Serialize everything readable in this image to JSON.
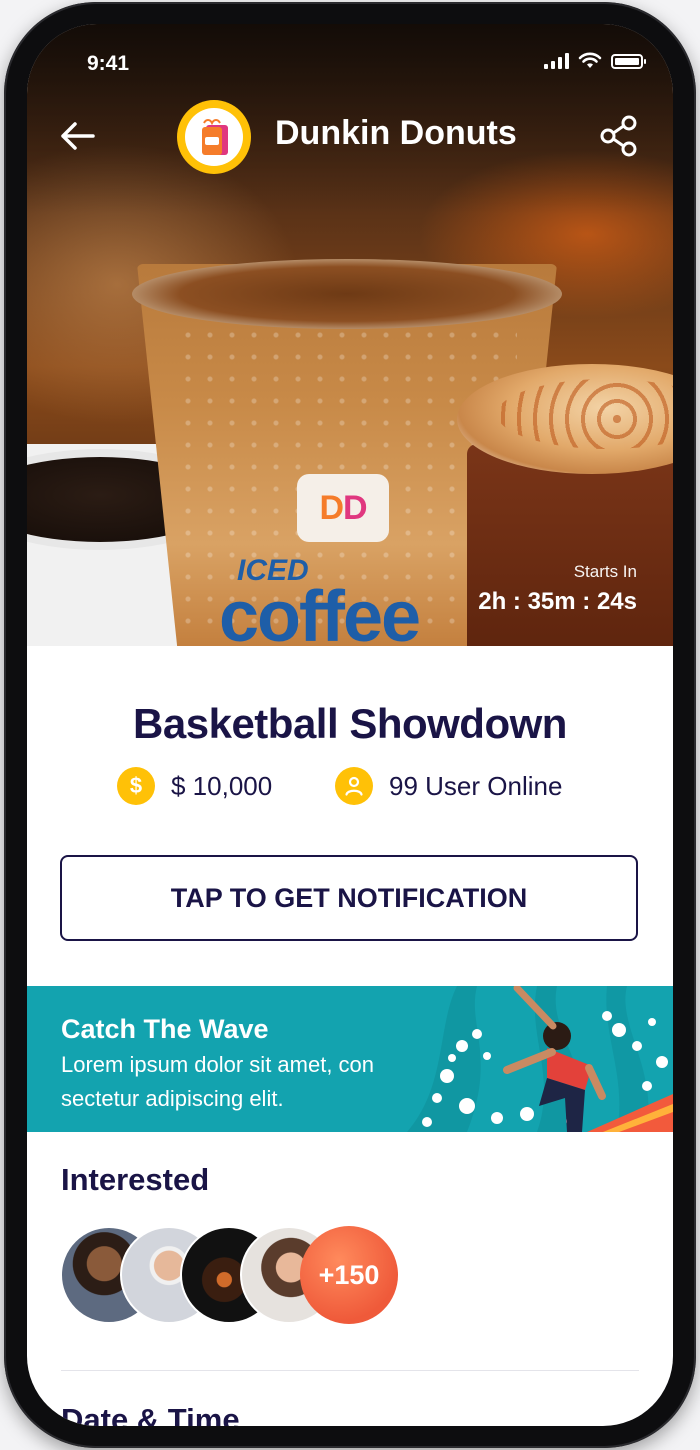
{
  "status_bar": {
    "time": "9:41"
  },
  "header": {
    "brand_name": "Dunkin Donuts",
    "back_icon": "arrow-left-icon",
    "share_icon": "share-icon"
  },
  "hero": {
    "logo_text": "DD",
    "cup_word_top": "ICED",
    "cup_word": "coffee",
    "countdown_label": "Starts In",
    "countdown_value": "2h : 35m : 24s"
  },
  "event": {
    "title": "Basketball Showdown",
    "prize": "$ 10,000",
    "prize_icon": "dollar-icon",
    "online": "99 User Online",
    "online_icon": "user-icon"
  },
  "notify_button": {
    "label": "TAP TO GET NOTIFICATION"
  },
  "banner": {
    "title": "Catch The Wave",
    "text": "Lorem ipsum dolor sit amet, con sectetur adipiscing elit."
  },
  "interested": {
    "title": "Interested",
    "more_label": "+150"
  },
  "date_time": {
    "title": "Date & Time"
  },
  "colors": {
    "accent": "#ffc107",
    "text_dark": "#1a1446",
    "banner_bg": "#13a3af",
    "more_badge": "#ef5a3a"
  }
}
